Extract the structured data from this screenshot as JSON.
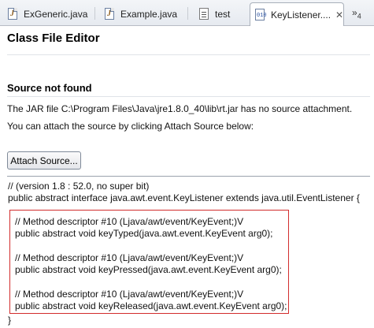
{
  "tabs": [
    {
      "label": "ExGeneric.java",
      "icon": "java-file-icon"
    },
    {
      "label": "Example.java",
      "icon": "java-file-icon"
    },
    {
      "label": "test",
      "icon": "text-file-icon"
    },
    {
      "label": "KeyListener....",
      "icon": "class-file-icon",
      "active": true,
      "close": "✕"
    }
  ],
  "overflow": {
    "glyph": "»",
    "count": "4"
  },
  "editor": {
    "title": "Class File Editor",
    "heading": "Source not found",
    "message_line1": "The JAR file C:\\Program Files\\Java\\jre1.8.0_40\\lib\\rt.jar has no source attachment.",
    "message_line2": "You can attach the source by clicking Attach Source below:",
    "attach_button": "Attach Source..."
  },
  "code": {
    "line1": "//  (version 1.8 : 52.0, no super bit)",
    "line2": "public abstract interface java.awt.event.KeyListener extends java.util.EventListener {",
    "m1_comment": "// Method descriptor #10 (Ljava/awt/event/KeyEvent;)V",
    "m1_sig": "public abstract void keyTyped(java.awt.event.KeyEvent arg0);",
    "m2_comment": "// Method descriptor #10 (Ljava/awt/event/KeyEvent;)V",
    "m2_sig": "public abstract void keyPressed(java.awt.event.KeyEvent arg0);",
    "m3_comment": "// Method descriptor #10 (Ljava/awt/event/KeyEvent;)V",
    "m3_sig": "public abstract void keyReleased(java.awt.event.KeyEvent arg0);",
    "closing": "}"
  },
  "colors": {
    "highlight_box": "#d22c2c"
  }
}
